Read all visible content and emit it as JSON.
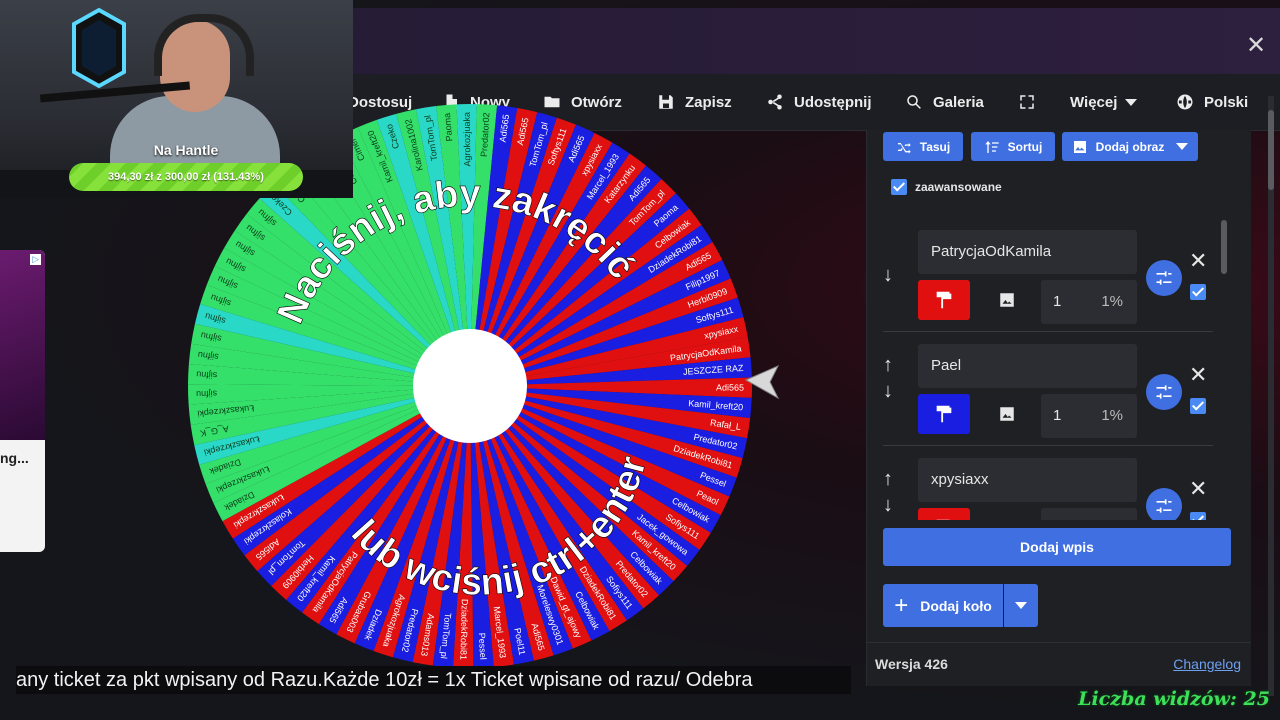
{
  "window": {
    "close_glyph": "✕"
  },
  "navbar": {
    "items": [
      {
        "label": "Dostosuj",
        "icon": "customize-icon"
      },
      {
        "label": "Nowy",
        "icon": "file-icon"
      },
      {
        "label": "Otwórz",
        "icon": "folder-open-icon"
      },
      {
        "label": "Zapisz",
        "icon": "save-icon"
      },
      {
        "label": "Udostępnij",
        "icon": "share-icon"
      },
      {
        "label": "Galeria",
        "icon": "search-icon"
      },
      {
        "label": "",
        "icon": "fullscreen-icon"
      },
      {
        "label": "Więcej",
        "icon": "chevron-down-icon"
      },
      {
        "label": "Polski",
        "icon": "globe-icon"
      }
    ]
  },
  "wheel": {
    "prompt_top": "Naciśnij, aby zakręcić",
    "prompt_bottom": "lub wciśnij ctrl+enter",
    "colors": {
      "green": "#35e06a",
      "cyan": "#2ad8c8",
      "red": "#e01010",
      "blue": "#1a1ee0"
    },
    "labels": [
      "PatrycjaOdKamila",
      "JESZCZE RAZ",
      "Adi565",
      "Kamil_kreft20",
      "Rafał_L",
      "Predator02",
      "DziadekRobi81",
      "Pessel",
      "Peaol",
      "Celbowiak",
      "Sofiys111",
      "Jacek_gowowa",
      "Kamil_kreft20",
      "Celbowiak",
      "Predator02",
      "Sofiys111",
      "DziadekRobi81",
      "Celbowiak",
      "Dawid_gt_ajowy",
      "Moreleswy0301",
      "Adi565",
      "Poel11",
      "Marcel_1993",
      "Pessel",
      "DziadekRobi81",
      "TomTom_pl",
      "Adams013",
      "Predator02",
      "Agrokozjuaka",
      "Dziadek",
      "Grubas003",
      "Adi565",
      "PatrycjaOdKamila",
      "Kamil_kreft20",
      "Herbi0909",
      "TomTom_pl",
      "Adi565",
      "Kolaszkrzepki",
      "Łukaszkrzepki",
      "Dziadek",
      "Łukaszkrzepki",
      "Dziadek",
      "Łukaszkrzepki",
      "A_G_K",
      "Łukaszkrzepki",
      "sijfnu",
      "sijfnu",
      "sijfnu",
      "sijfnu",
      "sijfnu",
      "sijfnu",
      "sijfnu",
      "sijfnu",
      "sijfnu",
      "sijfnu",
      "sijfnu",
      "Czeko",
      "Czeko",
      "Czeko",
      "Wheektrac",
      "Celbowiak",
      "Cimer",
      "Kamil_kreft20",
      "Czeko",
      "Karolina1002",
      "TomTom_pl",
      "Paoma",
      "Agrokozjuaka",
      "Predator02",
      "Adi565",
      "Adi565",
      "TomTom_pl",
      "Softys111",
      "Adi565",
      "xpysiaxx",
      "Marcel_1993",
      "Katarzynku",
      "Adi565",
      "TomTom_pl",
      "Paoma",
      "Celbowiak",
      "DziadekRobi81",
      "Adi565",
      "Filip1997",
      "Herbi0909",
      "Softys111",
      "xpysiaxx"
    ]
  },
  "webcam": {
    "goal_title": "Na Hantle",
    "goal_text": "394,30 zł z 300,00 zł (131.43%)",
    "goal_progress": 1.3143
  },
  "ad": {
    "badge": "▷",
    "text": "ng..."
  },
  "panel": {
    "toolbar": [
      {
        "label": "Tasuj",
        "icon": "shuffle-icon"
      },
      {
        "label": "Sortuj",
        "icon": "sort-icon"
      },
      {
        "label": "Dodaj obraz",
        "icon": "image-icon"
      }
    ],
    "advanced_label": "zaawansowane",
    "entries": [
      {
        "name": "PatrycjaOdKamila",
        "color": "#e01010",
        "weight": "1",
        "percent": "1%",
        "up": false,
        "down": true
      },
      {
        "name": "Pael",
        "color": "#1a1ee0",
        "weight": "1",
        "percent": "1%",
        "up": true,
        "down": true
      },
      {
        "name": "xpysiaxx",
        "color": "#e01010",
        "weight": "1",
        "percent": "1%",
        "up": true,
        "down": true
      }
    ],
    "add_entry_label": "Dodaj wpis",
    "add_wheel_label": "Dodaj koło",
    "version": "Wersja 426",
    "changelog": "Changelog"
  },
  "ticker": {
    "text": "any ticket za pkt wpisany od Razu.Każde 10zł = 1x Ticket wpisane od razu/ Odebra"
  },
  "viewers": {
    "text": "Liczba widzów: 25"
  }
}
